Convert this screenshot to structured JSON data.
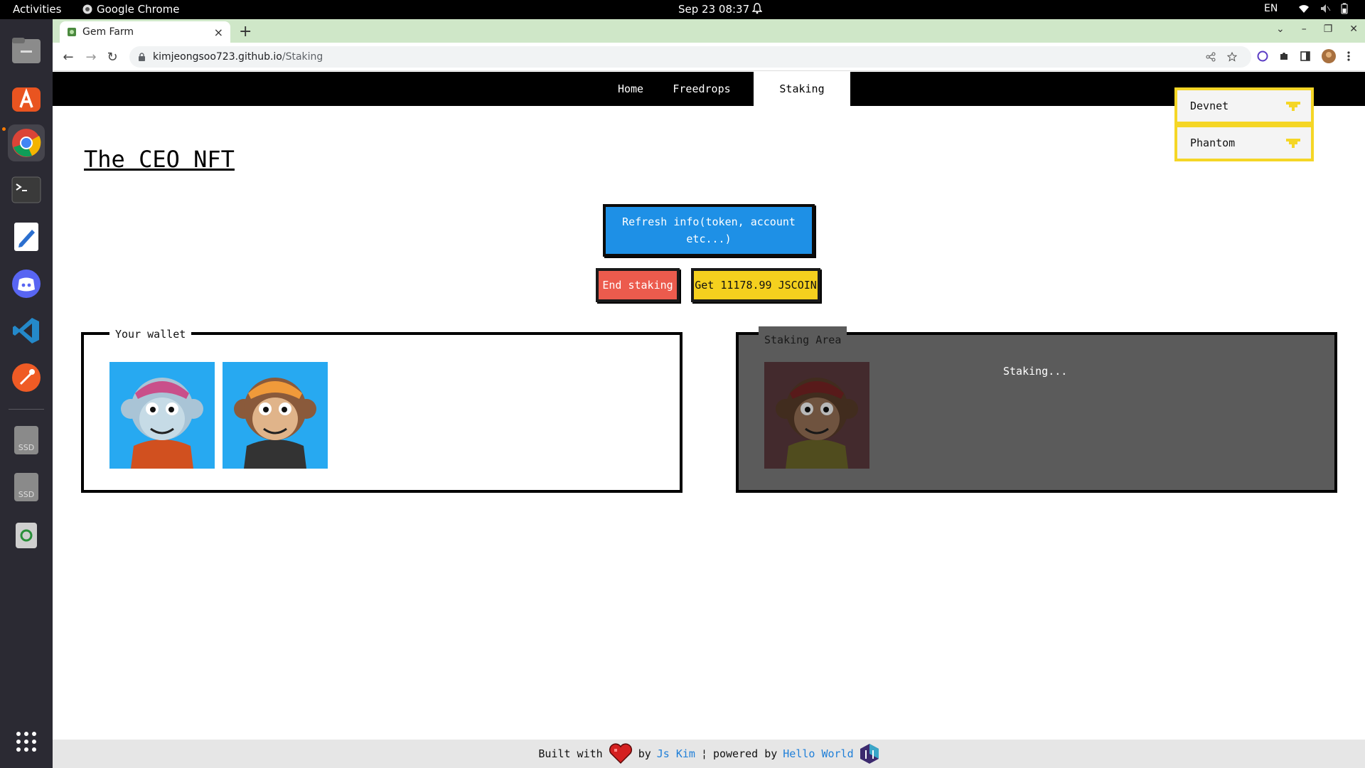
{
  "system": {
    "activities": "Activities",
    "app_name": "Google Chrome",
    "clock": "Sep 23  08:37",
    "language": "EN"
  },
  "browser": {
    "tab_title": "Gem Farm",
    "tab_close": "×",
    "new_tab": "+",
    "url_host": "kimjeongsoo723.github.io",
    "url_path": "/Staking"
  },
  "nav": {
    "items": [
      {
        "label": "Home"
      },
      {
        "label": "Freedrops"
      },
      {
        "label": "Staking",
        "active": true
      }
    ]
  },
  "site": {
    "title": "The CEO NFT"
  },
  "selects": {
    "network": "Devnet",
    "wallet": "Phantom"
  },
  "actions": {
    "refresh": "Refresh info(token, account etc...)",
    "end_staking": "End staking",
    "claim": "Get 11178.99 JSCOIN"
  },
  "wallet": {
    "legend": "Your wallet",
    "nfts": [
      {
        "name": "blue-ape-nft",
        "bg": "#27a9f1",
        "fur": "#a9c4d6",
        "face": "#c6dbe6",
        "hat": "#c94f8a",
        "shirt": "#d1501f"
      },
      {
        "name": "brown-ape-nft",
        "bg": "#27a9f1",
        "fur": "#8a5a3b",
        "face": "#e0b48a",
        "hat": "#f09a3a",
        "shirt": "#333333"
      }
    ]
  },
  "staking": {
    "legend": "Staking Area",
    "status": "Staking...",
    "nfts": [
      {
        "name": "staked-ape-nft",
        "bg": "#5e3b3f",
        "fur": "#5b3d2a",
        "face": "#9a7458",
        "hat": "#7a2424",
        "shirt": "#6f6a2a"
      }
    ]
  },
  "footer": {
    "built_with": "Built with",
    "by": "by",
    "author": "Js Kim",
    "separator": "¦",
    "powered_by": "powered by",
    "powered_name": "Hello World"
  },
  "colors": {
    "accent_blue": "#1e90e6",
    "danger": "#ec5b4d",
    "gold": "#f5d01e",
    "select_border": "#f5d626"
  }
}
